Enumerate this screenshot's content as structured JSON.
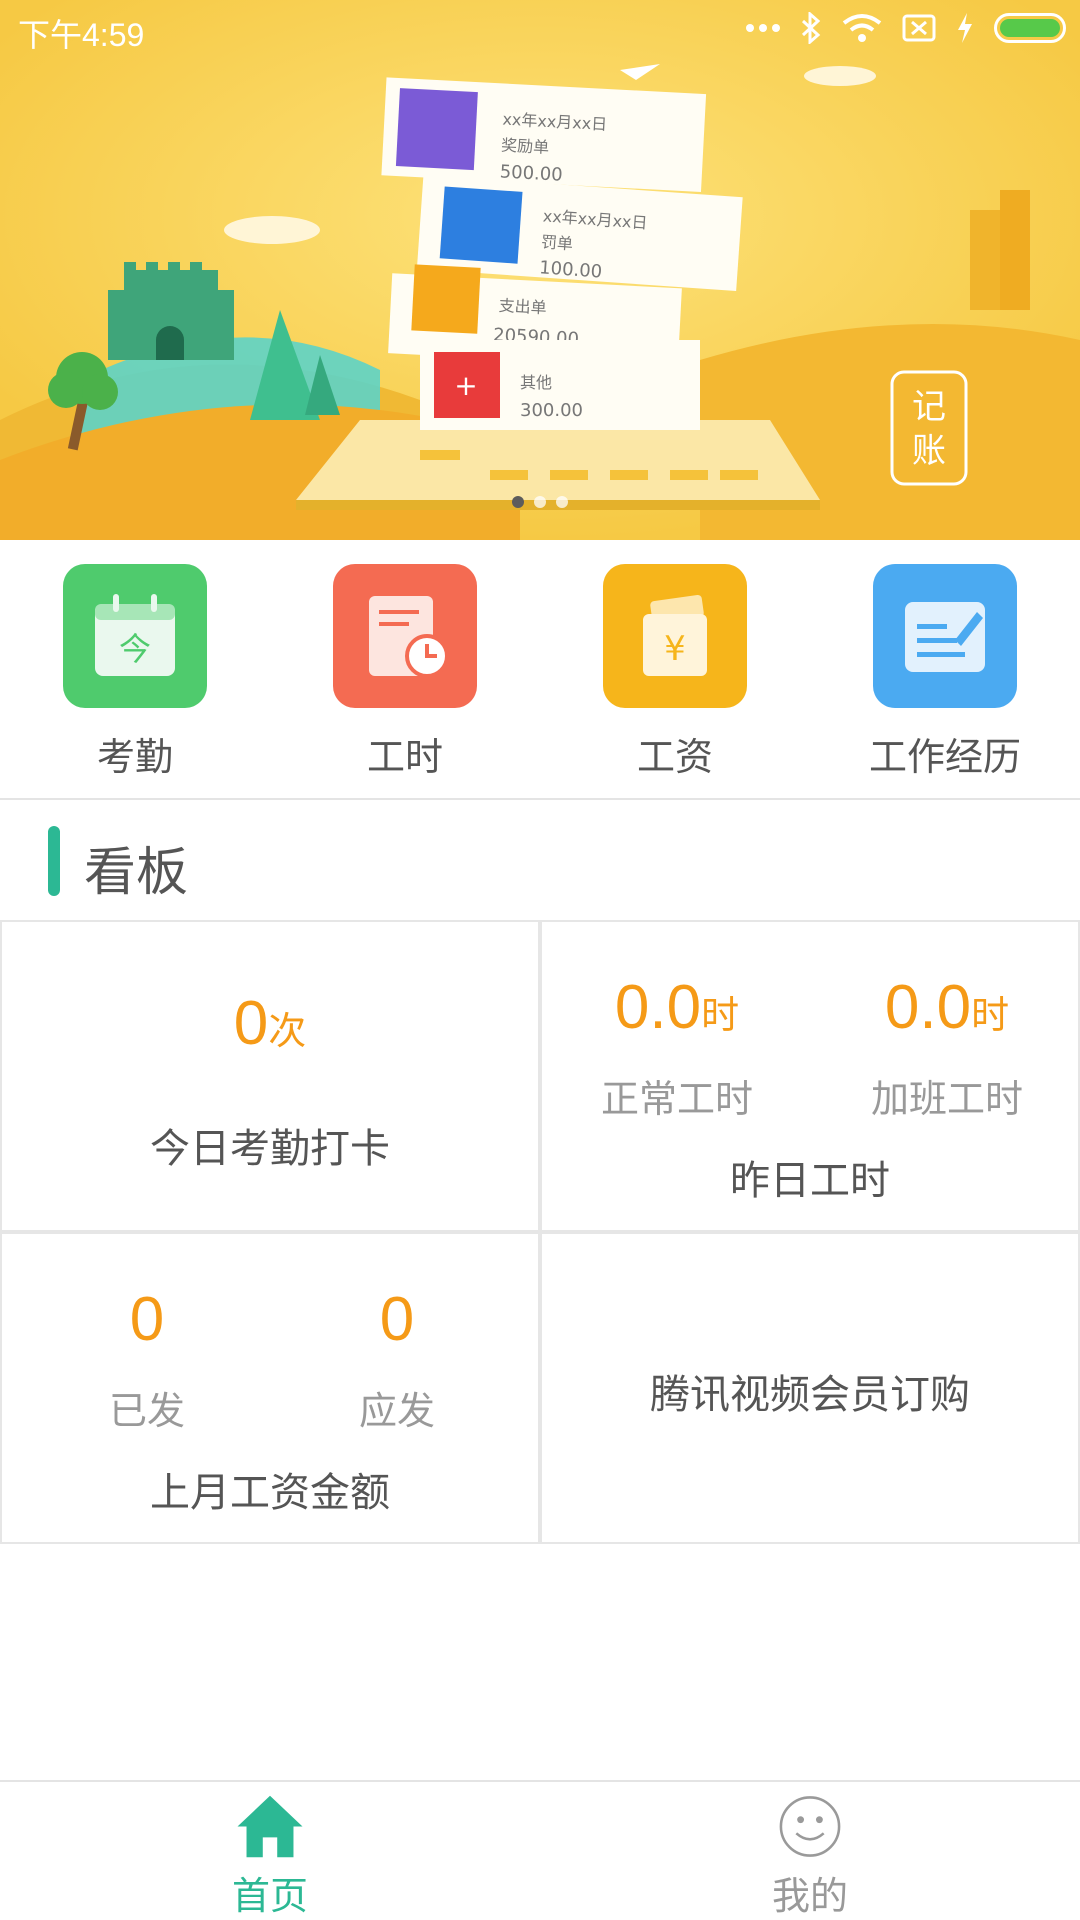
{
  "status_bar": {
    "time": "下午4:59",
    "icons": [
      "more-dots-icon",
      "bluetooth-icon",
      "wifi-icon",
      "no-sim-icon",
      "charging-icon",
      "battery-icon"
    ],
    "battery_color": "#57c94a"
  },
  "banner": {
    "background_color": "#f6c944",
    "cards": [
      {
        "date": "xx年xx月xx日",
        "title": "奖励单",
        "amount": "500.00",
        "icon": "trophy-icon",
        "color": "#7b5bd6"
      },
      {
        "date": "xx年xx月xx日",
        "title": "罚单",
        "amount": "100.00",
        "icon": "ticket-icon",
        "color": "#2d7fe0"
      },
      {
        "date": "",
        "title": "支出单",
        "amount": "20590.00",
        "icon": "pencil-icon",
        "color": "#f5a91c"
      },
      {
        "date": "",
        "title": "其他",
        "amount": "300.00",
        "icon": "folder-plus-icon",
        "color": "#e83b3b"
      }
    ],
    "stamp_text": "记账",
    "page_indicator": {
      "count": 3,
      "active": 0
    }
  },
  "quick_entries": [
    {
      "label": "考勤",
      "icon": "calendar-today-icon",
      "color": "#4fcb6d",
      "glyph": "今"
    },
    {
      "label": "工时",
      "icon": "clock-document-icon",
      "color": "#f46b52"
    },
    {
      "label": "工资",
      "icon": "salary-wallet-icon",
      "color": "#f6b51b",
      "glyph": "¥"
    },
    {
      "label": "工作经历",
      "icon": "edit-document-icon",
      "color": "#4baaf1"
    }
  ],
  "kanban": {
    "title": "看板",
    "accent_color": "#2cb894",
    "attendance": {
      "value": "0",
      "unit": "次",
      "label": "今日考勤打卡"
    },
    "hours": {
      "normal": {
        "value": "0.0",
        "unit": "时",
        "label": "正常工时"
      },
      "overtime": {
        "value": "0.0",
        "unit": "时",
        "label": "加班工时"
      },
      "label": "昨日工时"
    },
    "salary": {
      "paid": {
        "value": "0",
        "label": "已发"
      },
      "due": {
        "value": "0",
        "label": "应发"
      },
      "label": "上月工资金额"
    },
    "promo": {
      "label": "腾讯视频会员订购"
    }
  },
  "bottom_nav": {
    "items": [
      {
        "label": "首页",
        "icon": "home-icon",
        "active": true,
        "color": "#2cb894"
      },
      {
        "label": "我的",
        "icon": "smiley-icon",
        "active": false,
        "color": "#999999"
      }
    ]
  }
}
